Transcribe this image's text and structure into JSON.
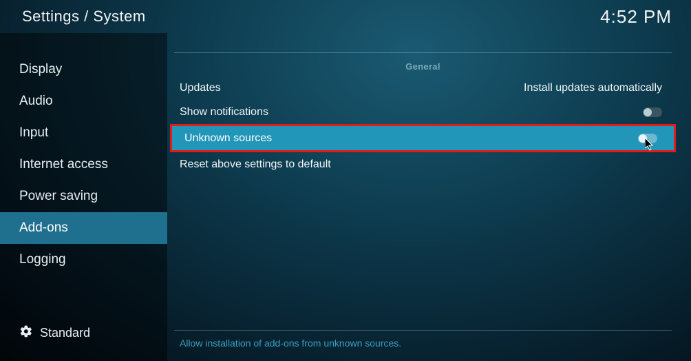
{
  "header": {
    "breadcrumb": "Settings / System",
    "clock": "4:52 PM"
  },
  "sidebar": {
    "items": [
      {
        "label": "Display"
      },
      {
        "label": "Audio"
      },
      {
        "label": "Input"
      },
      {
        "label": "Internet access"
      },
      {
        "label": "Power saving"
      },
      {
        "label": "Add-ons"
      },
      {
        "label": "Logging"
      }
    ],
    "level_label": "Standard"
  },
  "main": {
    "section_header": "General",
    "rows": {
      "updates": {
        "label": "Updates",
        "value": "Install updates automatically"
      },
      "show_notifications": {
        "label": "Show notifications"
      },
      "unknown_sources": {
        "label": "Unknown sources"
      },
      "reset": {
        "label": "Reset above settings to default"
      }
    },
    "footer_hint": "Allow installation of add-ons from unknown sources."
  }
}
